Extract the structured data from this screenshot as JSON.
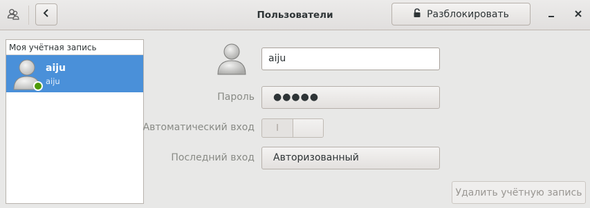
{
  "header": {
    "title": "Пользователи",
    "unlock_label": "Разблокировать",
    "icons": {
      "app": "users-icon",
      "back": "chevron-left-icon",
      "lock": "lock-icon",
      "minimize": "minimize-icon",
      "close": "close-icon"
    }
  },
  "sidebar": {
    "section_label": "Моя учётная запись",
    "users": [
      {
        "name": "aiju",
        "login": "aiju",
        "status": "online"
      }
    ]
  },
  "details": {
    "name_value": "aiju",
    "password_label": "Пароль",
    "password_value": "●●●●●",
    "autologin_label": "Автоматический вход",
    "autologin_on_text": "I",
    "last_login_label": "Последний вход",
    "last_login_value": "Авторизованный",
    "remove_label": "Удалить учётную запись"
  },
  "colors": {
    "selection": "#4a90d9",
    "online": "#4e9a06"
  }
}
